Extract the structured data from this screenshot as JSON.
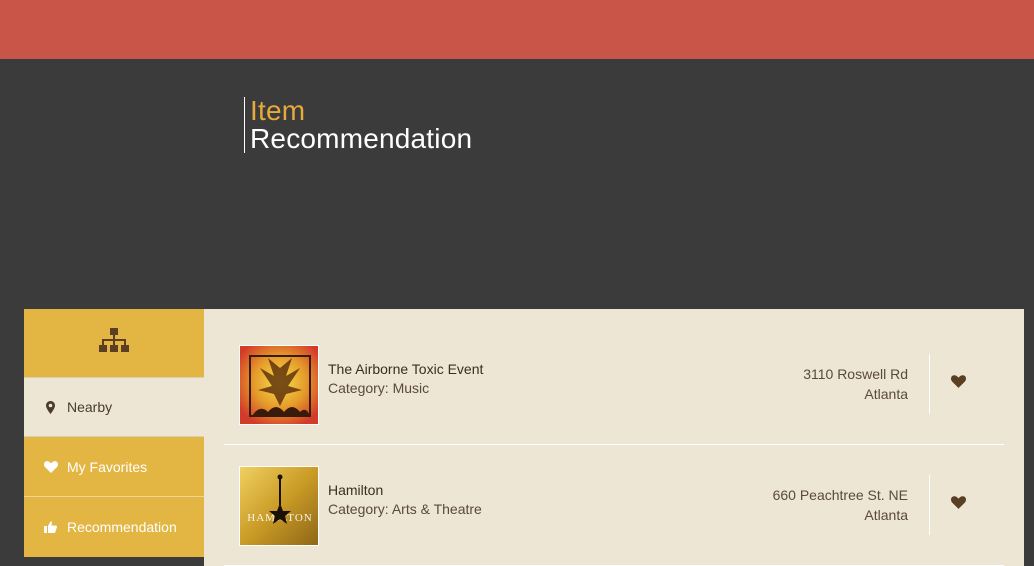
{
  "page": {
    "title_part1": "Item",
    "title_part2": "Recommendation"
  },
  "colors": {
    "top_bar": "#c85547",
    "hero_bg": "#3b3b3b",
    "accent": "#e6a93b",
    "sidebar_gold": "#e3b542",
    "content_bg": "#ede6d4"
  },
  "sidebar": {
    "header_icon": "sitemap-icon",
    "items": [
      {
        "label": "Nearby",
        "icon": "map-marker-icon"
      },
      {
        "label": "My Favorites",
        "icon": "heart-icon"
      },
      {
        "label": "Recommendation",
        "icon": "thumbs-up-icon"
      }
    ]
  },
  "items": [
    {
      "name": "The Airborne Toxic Event",
      "category": "Category: Music",
      "address_line1": "3110 Roswell Rd",
      "address_line2": "Atlanta",
      "favorite_icon": "heart-icon"
    },
    {
      "name": "Hamilton",
      "category": "Category: Arts & Theatre",
      "address_line1": "660 Peachtree St. NE",
      "address_line2": "Atlanta",
      "favorite_icon": "heart-icon",
      "image_text": "HAMILTON"
    }
  ]
}
